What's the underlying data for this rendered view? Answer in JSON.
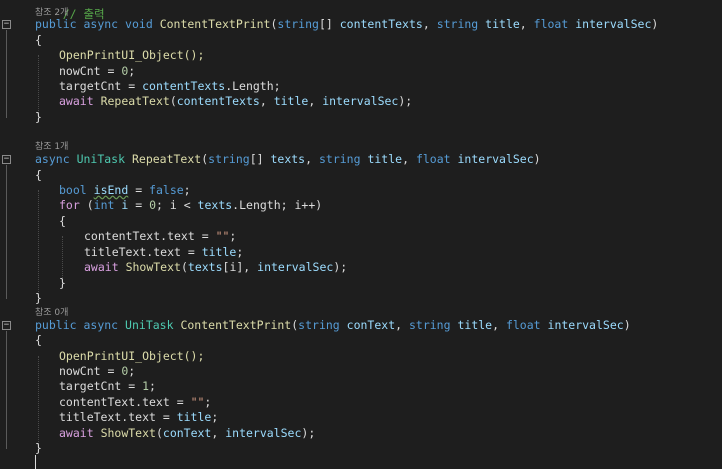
{
  "editor": {
    "top_comment": "// 출력",
    "lens_2": "참조 2개",
    "lens_1": "참조 1개",
    "lens_0": "참조 0개",
    "m1": {
      "mod": "public",
      "async": "async",
      "ret": "void",
      "name": "ContentTextPrint",
      "open_paren": "(",
      "t1": "string",
      "arr": "[] ",
      "p1": "contentTexts",
      "sep1": ", ",
      "t2": "string",
      "p2": "title",
      "sep2": ", ",
      "t3": "float",
      "p3": "intervalSec",
      "close_paren": ")",
      "open_brace": "{",
      "s1": "OpenPrintUI_Object();",
      "s2a": "nowCnt",
      "s2b": " = ",
      "s2c": "0",
      "s2d": ";",
      "s3a": "targetCnt",
      "s3b": " = ",
      "s3c": "contentTexts",
      "s3d": ".Length;",
      "s4a": "await",
      "s4b": "RepeatText",
      "s4c": "(",
      "s4d": "contentTexts",
      "s4e": ", ",
      "s4f": "title",
      "s4g": ", ",
      "s4h": "intervalSec",
      "s4i": ");",
      "close_brace": "}"
    },
    "m2": {
      "async": "async",
      "ret": "UniTask",
      "name": "RepeatText",
      "open_paren": "(",
      "t1": "string",
      "arr": "[] ",
      "p1": "texts",
      "sep1": ", ",
      "t2": "string",
      "p2": "title",
      "sep2": ", ",
      "t3": "float",
      "p3": "intervalSec",
      "close_paren": ")",
      "open_brace": "{",
      "b1": "bool",
      "b2": "isEnd",
      "b3": " = ",
      "b4": "false",
      "b5": ";",
      "f1": "for",
      "f2": " (",
      "f3": "int",
      "f4": " i",
      "f5": " = ",
      "f6": "0",
      "f7": "; i < ",
      "f8": "texts",
      "f9": ".Length; i++)",
      "inner_open": "{",
      "c1": "contentText.text = ",
      "c2": "\"\"",
      "c3": ";",
      "t1a": "titleText.text = ",
      "t1b": "title",
      "t1c": ";",
      "w1": "await",
      "w2": "ShowText",
      "w3": "(",
      "w4": "texts",
      "w5": "[i], ",
      "w6": "intervalSec",
      "w7": ");",
      "inner_close": "}",
      "close_brace": "}"
    },
    "m3": {
      "mod": "public",
      "async": "async",
      "ret": "UniTask",
      "name": "ContentTextPrint",
      "open_paren": "(",
      "t1": "string",
      "p1": "conText",
      "sep1": ", ",
      "t2": "string",
      "p2": "title",
      "sep2": ", ",
      "t3": "float",
      "p3": "intervalSec",
      "close_paren": ")",
      "open_brace": "{",
      "s1": "OpenPrintUI_Object();",
      "s2a": "nowCnt",
      "s2b": " = ",
      "s2c": "0",
      "s2d": ";",
      "s3a": "targetCnt",
      "s3b": " = ",
      "s3c": "1",
      "s3d": ";",
      "s4a": "contentText.text = ",
      "s4b": "\"\"",
      "s4c": ";",
      "s5a": "titleText.text = ",
      "s5b": "title",
      "s5c": ";",
      "s6a": "await",
      "s6b": "ShowText",
      "s6c": "(",
      "s6d": "conText",
      "s6e": ", ",
      "s6f": "intervalSec",
      "s6g": ");",
      "close_brace": "}"
    }
  }
}
